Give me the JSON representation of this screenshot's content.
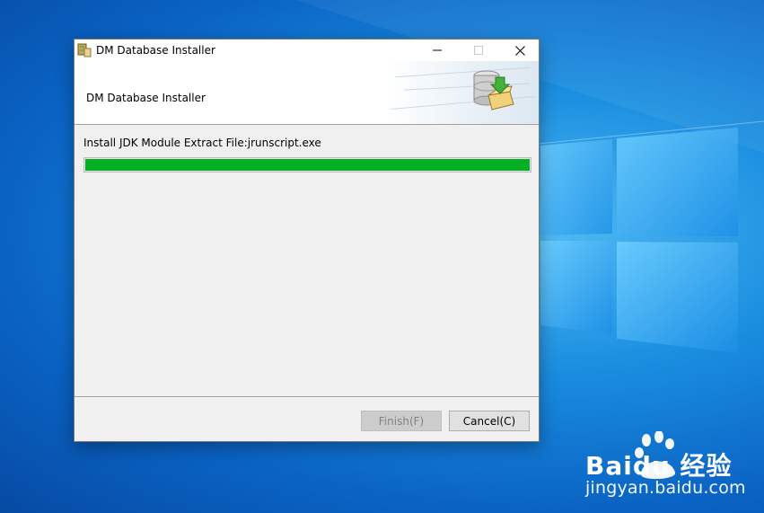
{
  "window": {
    "title": "DM Database Installer",
    "header_title": "DM Database Installer",
    "controls": {
      "minimize": "minimize-icon",
      "maximize": "maximize-icon",
      "close": "close-icon"
    }
  },
  "install": {
    "status": "Install JDK Module Extract File:jrunscript.exe",
    "progress": 1.0,
    "progress_color": "#06b025"
  },
  "buttons": {
    "finish": "Finish(F)",
    "cancel": "Cancel(C)"
  },
  "watermark": {
    "brand": "Baidu 经验",
    "url": "jingyan.baidu.com"
  }
}
